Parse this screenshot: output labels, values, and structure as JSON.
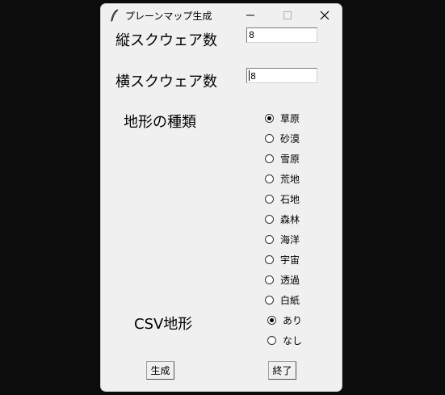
{
  "window": {
    "title": "プレーンマップ生成",
    "icons": {
      "app": "feather-icon",
      "minimize": "minimize-icon",
      "maximize": "maximize-icon",
      "close": "close-icon"
    }
  },
  "form": {
    "rows_label": "縦スクウェア数",
    "rows_value": "8",
    "cols_label": "横スクウェア数",
    "cols_value": "8",
    "terrain_label": "地形の種類",
    "terrain_options": [
      {
        "label": "草原",
        "selected": true
      },
      {
        "label": "砂漠",
        "selected": false
      },
      {
        "label": "雪原",
        "selected": false
      },
      {
        "label": "荒地",
        "selected": false
      },
      {
        "label": "石地",
        "selected": false
      },
      {
        "label": "森林",
        "selected": false
      },
      {
        "label": "海洋",
        "selected": false
      },
      {
        "label": "宇宙",
        "selected": false
      },
      {
        "label": "透過",
        "selected": false
      },
      {
        "label": "白紙",
        "selected": false
      }
    ],
    "csv_label": "CSV地形",
    "csv_options": [
      {
        "label": "あり",
        "selected": true
      },
      {
        "label": "なし",
        "selected": false
      }
    ]
  },
  "buttons": {
    "generate": "生成",
    "exit": "終了"
  }
}
